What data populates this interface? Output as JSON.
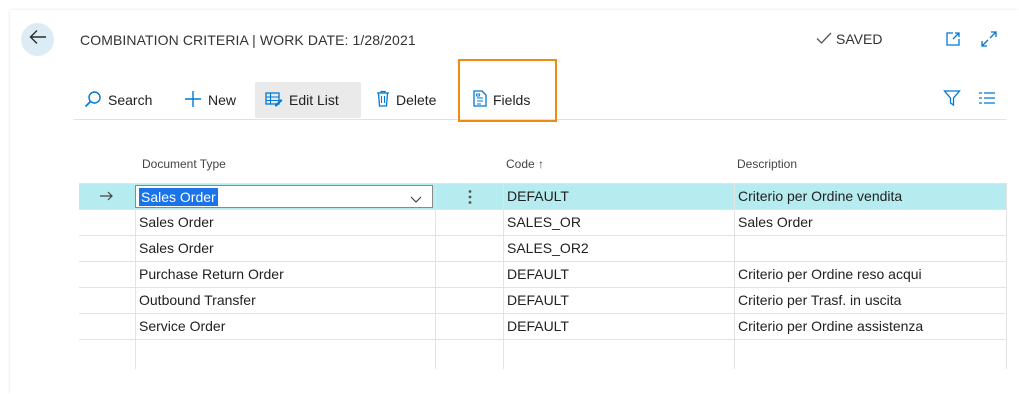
{
  "header": {
    "title": "COMBINATION CRITERIA | WORK DATE: 1/28/2021",
    "saved_label": "SAVED"
  },
  "toolbar": {
    "search_label": "Search",
    "new_label": "New",
    "edit_list_label": "Edit List",
    "delete_label": "Delete",
    "fields_label": "Fields"
  },
  "columns": {
    "document_type": "Document Type",
    "code": "Code ↑",
    "description": "Description"
  },
  "rows": [
    {
      "document_type": "Sales Order",
      "code": "DEFAULT",
      "description": "Criterio per Ordine vendita"
    },
    {
      "document_type": "Sales Order",
      "code": "SALES_OR",
      "description": "Sales Order"
    },
    {
      "document_type": "Sales Order",
      "code": "SALES_OR2",
      "description": ""
    },
    {
      "document_type": "Purchase Return Order",
      "code": "DEFAULT",
      "description": "Criterio per Ordine reso acqui"
    },
    {
      "document_type": "Outbound Transfer",
      "code": "DEFAULT",
      "description": "Criterio per Trasf. in uscita"
    },
    {
      "document_type": "Service Order",
      "code": "DEFAULT",
      "description": "Criterio per Ordine assistenza"
    },
    {
      "document_type": "",
      "code": "",
      "description": ""
    }
  ],
  "icons": {
    "back": "back-arrow-icon",
    "saved": "checkmark-icon",
    "open_new_window": "open-in-new-window-icon",
    "expand": "expand-icon",
    "search": "search-icon",
    "new": "plus-icon",
    "edit_list": "edit-list-icon",
    "delete": "trash-icon",
    "fields": "fields-icon",
    "filter": "filter-icon",
    "list_view": "list-view-icon",
    "row_selector": "row-arrow-icon",
    "row_actions": "more-vertical-icon",
    "dropdown": "chevron-down-icon"
  },
  "colors": {
    "selected_row": "#b6ecf0",
    "selection_text_bg": "#1a73e8",
    "accent": "#0078d4",
    "highlight_box": "#ef8a12",
    "back_button_bg": "#dcecf5"
  }
}
